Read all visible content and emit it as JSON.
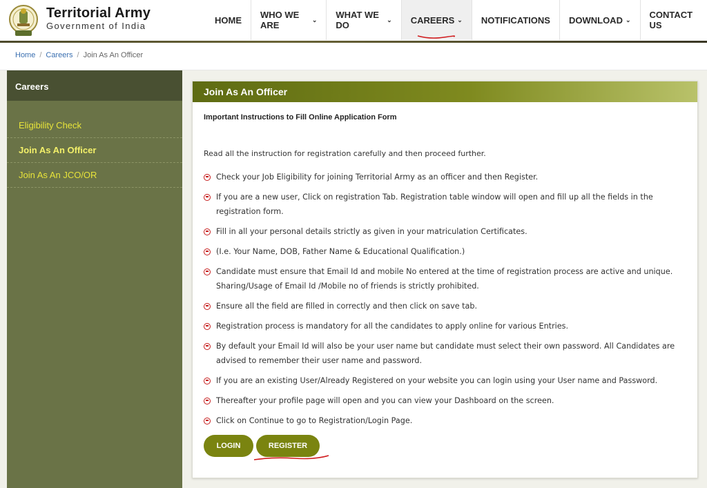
{
  "brand": {
    "title": "Territorial Army",
    "subtitle": "Government of India",
    "emblem_icon": "national-emblem"
  },
  "nav": [
    {
      "label": "HOME",
      "has_dropdown": false
    },
    {
      "label": "WHO WE ARE",
      "has_dropdown": true
    },
    {
      "label": "WHAT WE DO",
      "has_dropdown": true
    },
    {
      "label": "CAREERS",
      "has_dropdown": true,
      "active": true
    },
    {
      "label": "NOTIFICATIONS",
      "has_dropdown": false
    },
    {
      "label": "DOWNLOAD",
      "has_dropdown": true
    },
    {
      "label": "CONTACT US",
      "has_dropdown": false
    }
  ],
  "breadcrumb": {
    "home": "Home",
    "section": "Careers",
    "current": "Join As An Officer"
  },
  "sidebar": {
    "heading": "Careers",
    "items": [
      {
        "label": "Eligibility Check"
      },
      {
        "label": "Join As An Officer",
        "active": true
      },
      {
        "label": "Join As An JCO/OR"
      }
    ]
  },
  "main": {
    "title": "Join As An Officer",
    "instructions_heading": "Important Instructions to Fill Online Application Form",
    "intro": "Read all the instruction for registration carefully and then proceed further.",
    "bullets": [
      "Check your Job Eligibility for joining Territorial Army as an officer and then Register.",
      " If you are a new user, Click on registration Tab. Registration table window will open and fill up all the fields in the registration form.",
      "Fill in all your personal details strictly as given in your matriculation Certificates.",
      "(I.e. Your Name, DOB, Father Name & Educational Qualification.)",
      "Candidate must ensure that Email Id and mobile No entered at the time of registration process are active and unique. Sharing/Usage of Email Id /Mobile no of friends is strictly prohibited.",
      "Ensure all the field are filled in correctly and then click on save tab.",
      "Registration process is mandatory for all the candidates to apply online for various Entries.",
      "By default your Email Id will also be your user name but candidate must select their own password. All Candidates are advised to remember their user name and password.",
      "If you are an existing User/Already Registered on your website you can login using your User name and Password.",
      "Thereafter your profile page will open and you can view your Dashboard on the screen.",
      "Click on Continue to go to Registration/Login Page."
    ],
    "login_label": "LOGIN",
    "register_label": "REGISTER"
  },
  "colors": {
    "accent": "#7a8410",
    "sidebar_bg": "#6a7347",
    "sidebar_link": "#e8e43a",
    "bullet_icon": "#c61b1b",
    "annotation": "#d0181b"
  }
}
